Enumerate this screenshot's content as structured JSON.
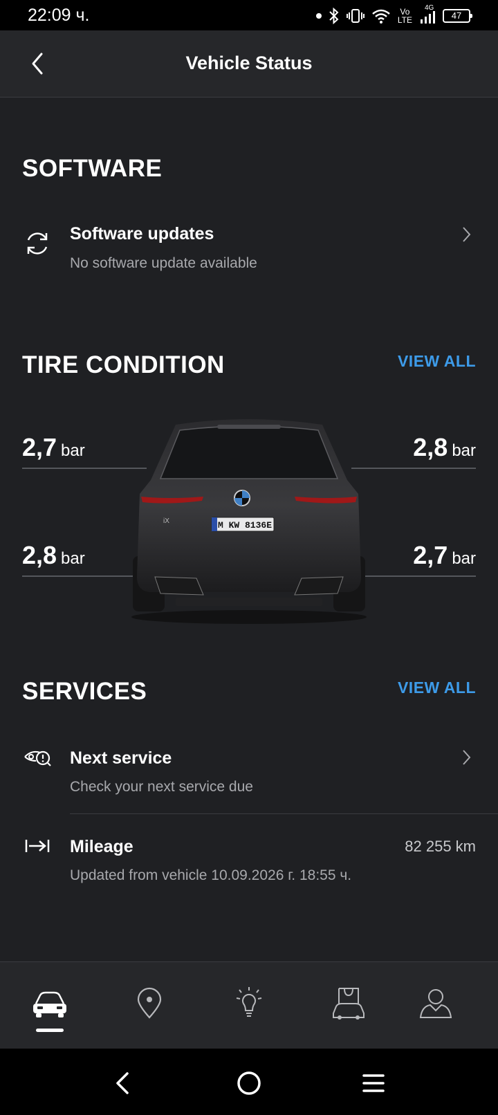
{
  "status_bar": {
    "time": "22:09 ч.",
    "network_top": "Vo",
    "network_bottom": "LTE",
    "signal_label": "4G",
    "battery": "47"
  },
  "header": {
    "title": "Vehicle Status"
  },
  "software": {
    "section_title": "SOFTWARE",
    "item_title": "Software updates",
    "item_subtitle": "No software update available"
  },
  "tires": {
    "section_title": "TIRE CONDITION",
    "view_all": "VIEW ALL",
    "front_left": "2,7",
    "front_right": "2,8",
    "rear_left": "2,8",
    "rear_right": "2,7",
    "unit": "bar"
  },
  "services": {
    "section_title": "SERVICES",
    "view_all": "VIEW ALL",
    "next_service_title": "Next service",
    "next_service_subtitle": "Check your next service due",
    "mileage_title": "Mileage",
    "mileage_value": "82 255 km",
    "mileage_subtitle": "Updated from vehicle 10.09.2026 г. 18:55 ч."
  },
  "vehicle": {
    "plate": "M KW 8136E",
    "model_badge": "iX"
  },
  "tabbar": {
    "tabs": [
      "vehicle-icon",
      "location-pin-icon",
      "lightbulb-icon",
      "shop-icon",
      "profile-icon"
    ],
    "active_index": 0
  },
  "colors": {
    "accent": "#3d9be9",
    "background": "#1f2023",
    "header": "#26272a"
  }
}
